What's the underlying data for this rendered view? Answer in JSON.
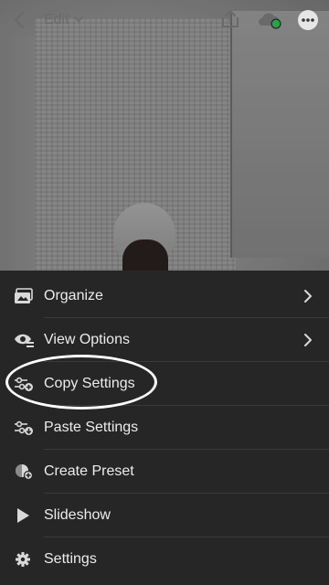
{
  "topbar": {
    "edit_label": "Edit",
    "icons": [
      "back-arrow-icon",
      "chevron-down-icon",
      "share-icon",
      "cloud-sync-icon",
      "more-icon"
    ],
    "sync_status_color": "#2aa14a"
  },
  "menu": {
    "items": [
      {
        "label": "Organize",
        "icon": "organize-icon",
        "has_chevron": true
      },
      {
        "label": "View Options",
        "icon": "view-options-icon",
        "has_chevron": true
      },
      {
        "label": "Copy Settings",
        "icon": "copy-settings-icon",
        "has_chevron": false,
        "highlighted": true
      },
      {
        "label": "Paste Settings",
        "icon": "paste-settings-icon",
        "has_chevron": false
      },
      {
        "label": "Create Preset",
        "icon": "create-preset-icon",
        "has_chevron": false
      },
      {
        "label": "Slideshow",
        "icon": "play-icon",
        "has_chevron": false
      },
      {
        "label": "Settings",
        "icon": "gear-icon",
        "has_chevron": false
      }
    ]
  },
  "colors": {
    "sheet_background": "#262626",
    "text": "#ececec",
    "highlight": "#ffffff"
  }
}
